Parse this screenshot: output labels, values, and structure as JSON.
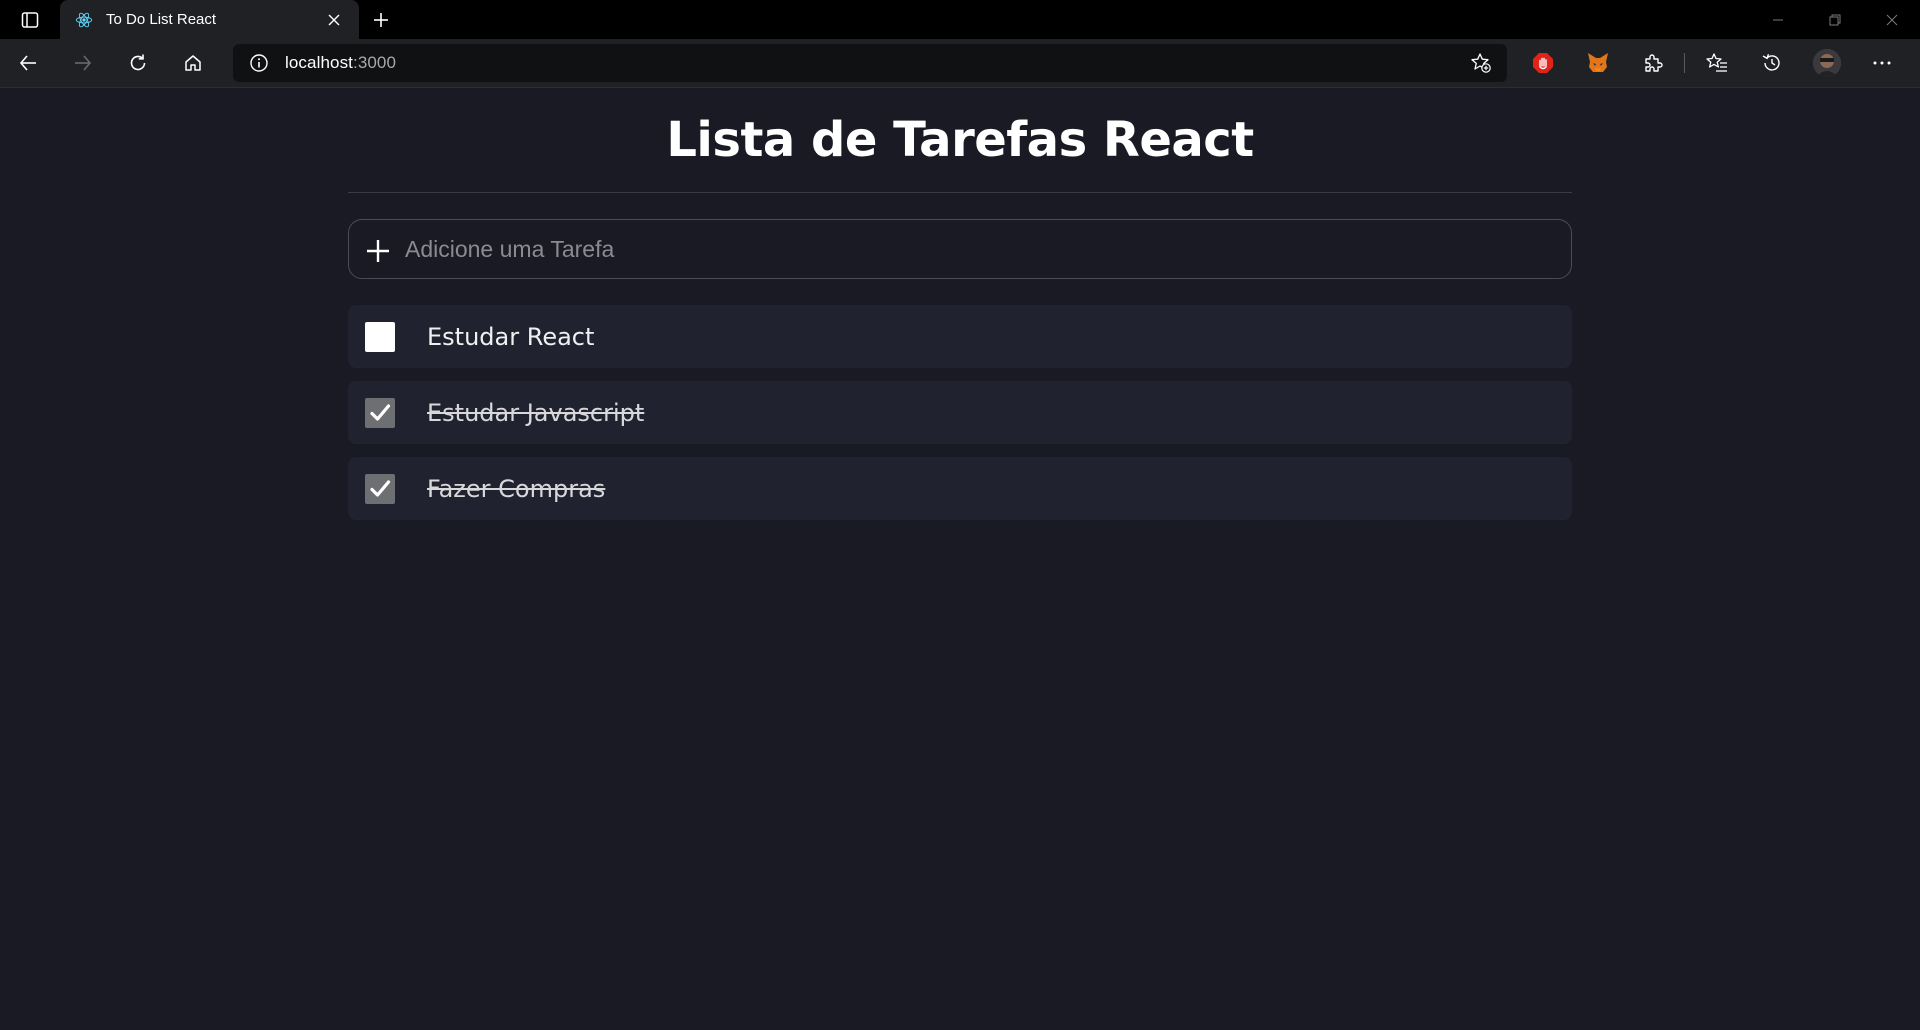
{
  "browser": {
    "tab": {
      "title": "To Do List React",
      "favicon": "react-icon"
    },
    "address": {
      "host": "localhost",
      "port": ":3000"
    },
    "icons": {
      "back": "arrow-left-icon",
      "forward": "arrow-right-icon",
      "reload": "reload-icon",
      "home": "home-icon",
      "info": "info-icon",
      "favorite_add": "star-add-icon",
      "extensions": "puzzle-icon",
      "favorites": "favorites-icon",
      "history": "history-icon",
      "more": "more-icon"
    }
  },
  "app": {
    "title": "Lista de Tarefas React",
    "input": {
      "placeholder": "Adicione uma Tarefa",
      "value": ""
    },
    "tasks": [
      {
        "label": "Estudar React",
        "done": false
      },
      {
        "label": "Estudar Javascript",
        "done": true
      },
      {
        "label": "Fazer Compras",
        "done": true
      }
    ]
  },
  "colors": {
    "background": "#191a23",
    "task_background": "#212230",
    "text": "#ffffff",
    "checked_box": "#6e6f73"
  }
}
